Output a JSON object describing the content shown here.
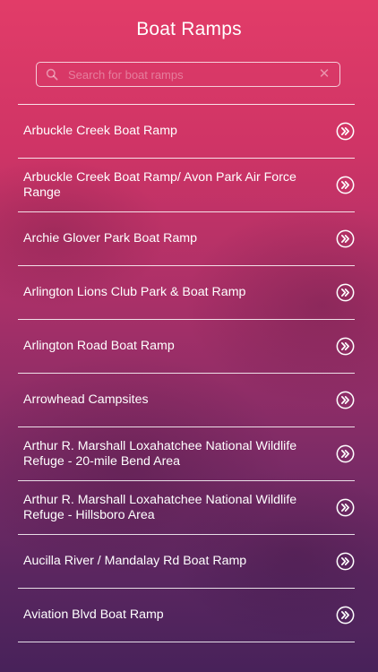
{
  "header": {
    "title": "Boat Ramps"
  },
  "search": {
    "placeholder": "Search for boat ramps",
    "value": "",
    "search_icon": "search-icon",
    "clear_icon": "close-icon",
    "clear_glyph": "✕"
  },
  "list": {
    "item_icon": "double-chevron-right-icon",
    "items": [
      {
        "label": "Arbuckle Creek Boat Ramp"
      },
      {
        "label": "Arbuckle Creek Boat Ramp/ Avon Park Air Force Range"
      },
      {
        "label": "Archie Glover Park Boat Ramp"
      },
      {
        "label": "Arlington Lions Club Park & Boat Ramp"
      },
      {
        "label": "Arlington Road Boat Ramp"
      },
      {
        "label": "Arrowhead Campsites"
      },
      {
        "label": "Arthur R. Marshall Loxahatchee National Wildlife Refuge - 20-mile Bend Area"
      },
      {
        "label": "Arthur R. Marshall Loxahatchee National Wildlife Refuge - Hillsboro Area"
      },
      {
        "label": "Aucilla River / Mandalay Rd Boat Ramp"
      },
      {
        "label": "Aviation Blvd Boat Ramp"
      }
    ]
  },
  "colors": {
    "gradient_top": "#e23c68",
    "gradient_bottom": "#48225a",
    "foreground": "#ffffff"
  }
}
